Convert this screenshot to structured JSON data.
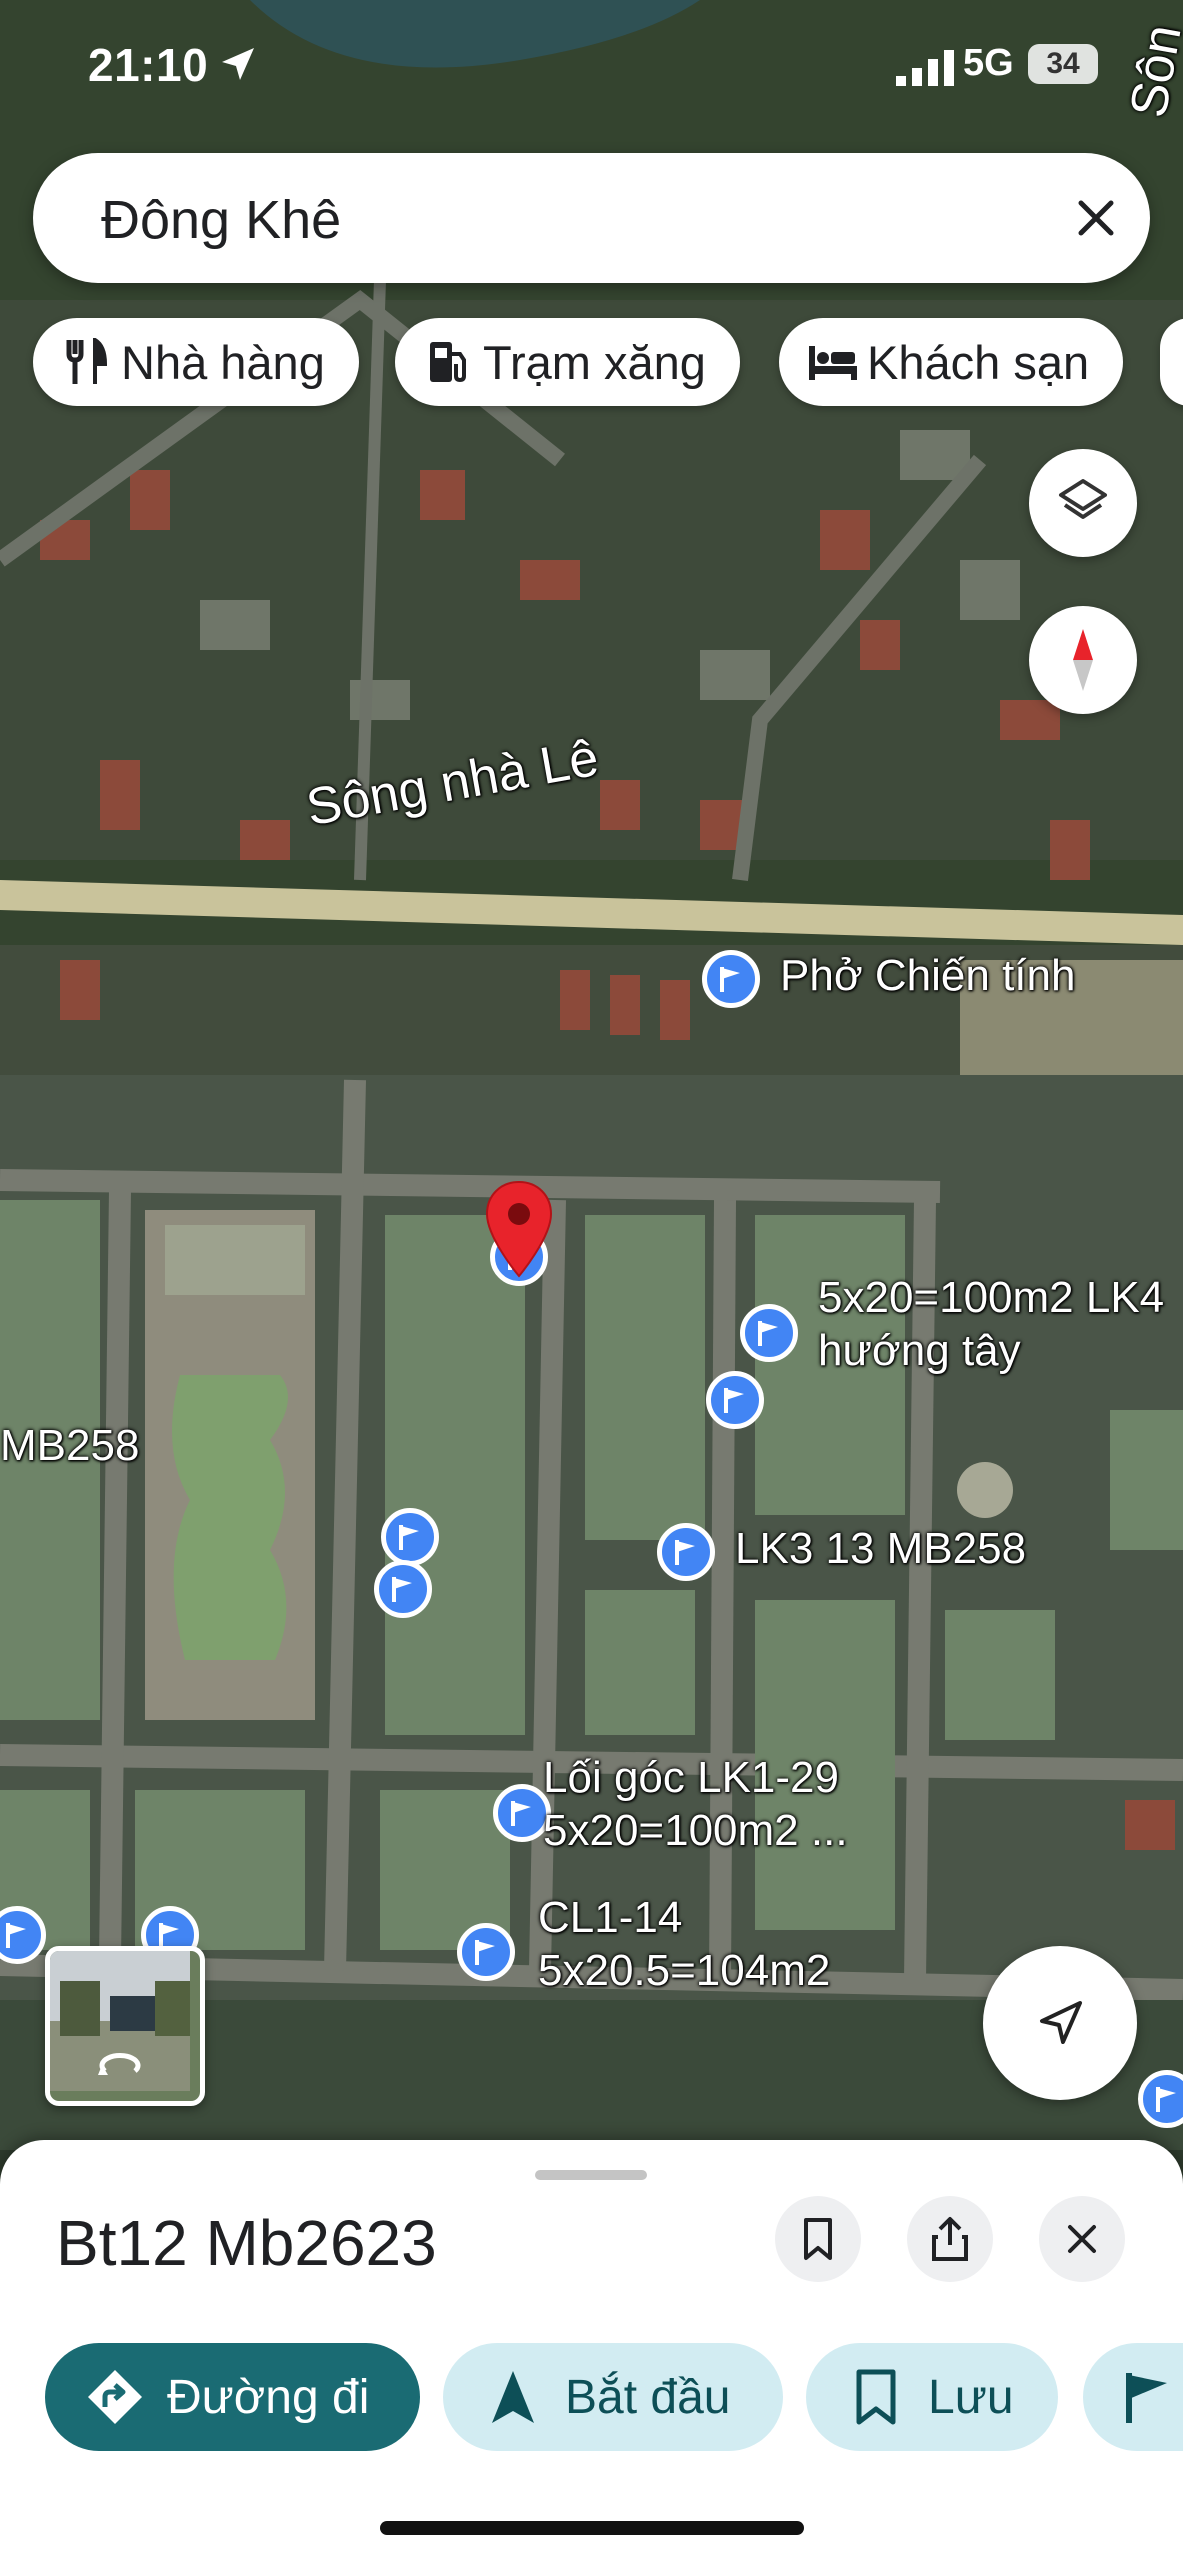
{
  "status_bar": {
    "time": "21:10",
    "network": "5G",
    "battery": "34"
  },
  "search": {
    "query": "Đông Khê"
  },
  "chips": [
    {
      "label": "Nhà hàng",
      "icon": "restaurant-icon"
    },
    {
      "label": "Trạm xăng",
      "icon": "gas-station-icon"
    },
    {
      "label": "Khách sạn",
      "icon": "hotel-icon"
    }
  ],
  "map": {
    "river_label": "Sông nhà Lê",
    "river_label_top": "Sôn",
    "partial_label_left": "MB258",
    "places": [
      {
        "label": "Phở Chiến tính"
      },
      {
        "label": "5x20=100m2 LK4",
        "label2": "hướng tây"
      },
      {
        "label": "LK3 13 MB258"
      },
      {
        "label": "Lối góc LK1-29",
        "label2": "5x20=100m2 ..."
      },
      {
        "label": "CL1-14",
        "label2": "5x20.5=104m2"
      }
    ]
  },
  "sheet": {
    "title": "Bt12 Mb2623",
    "actions": [
      {
        "label": "Đường đi",
        "icon": "directions-icon"
      },
      {
        "label": "Bắt đầu",
        "icon": "navigation-start-icon"
      },
      {
        "label": "Lưu",
        "icon": "bookmark-icon"
      }
    ]
  },
  "colors": {
    "accent": "#1a6b73",
    "chip_light": "#d2ecf2",
    "pin_blue": "#4285f4",
    "pin_red": "#e8232b"
  }
}
